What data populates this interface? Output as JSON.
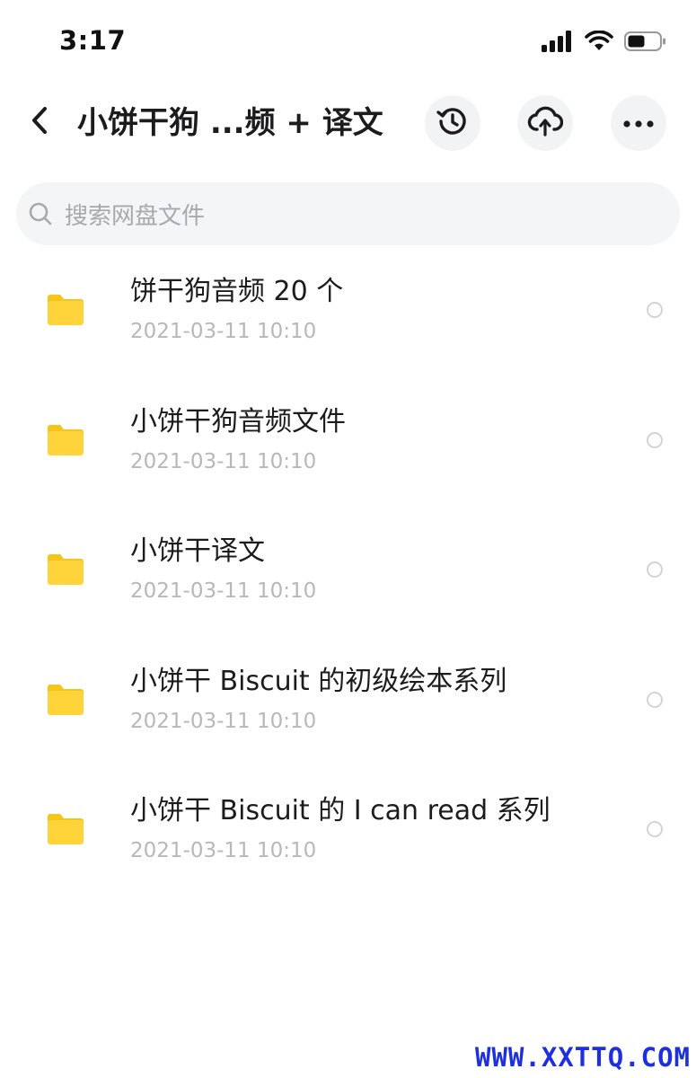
{
  "status_bar": {
    "time": "3:17",
    "icons": [
      "signal-icon",
      "wifi-icon",
      "battery-icon"
    ]
  },
  "header": {
    "title": "小饼干狗 ...频 + 译文",
    "back_icon": "back-arrow-icon",
    "buttons": [
      {
        "name": "history",
        "icon": "history-icon"
      },
      {
        "name": "upload",
        "icon": "cloud-upload-icon"
      },
      {
        "name": "more",
        "icon": "more-dots-icon"
      }
    ]
  },
  "search": {
    "placeholder": "搜索网盘文件"
  },
  "files": [
    {
      "name": "饼干狗音频 20 个",
      "date": "2021-03-11 10:10",
      "type": "folder"
    },
    {
      "name": "小饼干狗音频文件",
      "date": "2021-03-11 10:10",
      "type": "folder"
    },
    {
      "name": "小饼干译文",
      "date": "2021-03-11 10:10",
      "type": "folder"
    },
    {
      "name": "小饼干 Biscuit 的初级绘本系列",
      "date": "2021-03-11 10:10",
      "type": "folder"
    },
    {
      "name": "小饼干 Biscuit 的 I can read 系列",
      "date": "2021-03-11 10:10",
      "type": "folder"
    }
  ],
  "watermark": "WWW.XXTTQ.COM",
  "colors": {
    "folder": "#ffd43b",
    "folder_tab": "#f5c518",
    "date_text": "#b6b8bc",
    "watermark": "#1d2fe0"
  }
}
